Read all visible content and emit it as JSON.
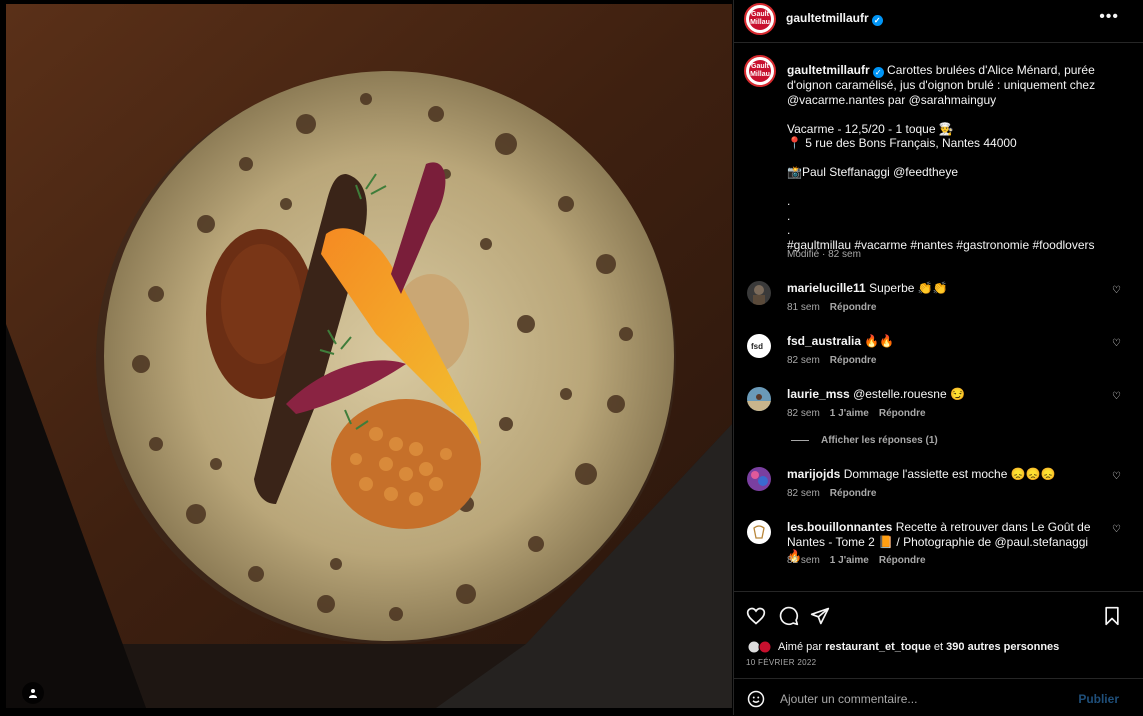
{
  "post": {
    "username": "gaultetmillaufr",
    "logo_text": "Gault Millau",
    "more_icon": "more-horizontal-icon",
    "caption": {
      "username": "gaultetmillaufr",
      "text": "Carottes brulées d'Alice Ménard, purée d'oignon caramélisé, jus d'oignon brulé : uniquement chez @vacarme.nantes par @sarahmainguy\n\nVacarme - 12,5/20 - 1 toque 👨‍🍳\n📍 5 rue des Bons Français, Nantes 44000\n\n📸Paul Steffanaggi @feedtheye\n\n.\n.\n.\n#gaultmillau #vacarme #nantes #gastronomie #foodlovers",
      "meta": "Modifié · 82 sem"
    }
  },
  "comments": [
    {
      "username": "marielucille11",
      "text": "Superbe 👏👏",
      "time": "81 sem",
      "likes": "",
      "reply": "Répondre",
      "avatar_color": "#3a3a3a"
    },
    {
      "username": "fsd_australia",
      "text": "🔥🔥",
      "time": "82 sem",
      "likes": "",
      "reply": "Répondre",
      "avatar_color": "#ffffff"
    },
    {
      "username": "laurie_mss",
      "text": "@estelle.rouesne 😏",
      "time": "82 sem",
      "likes": "1 J'aime",
      "reply": "Répondre",
      "avatar_color": "#6a9ab8"
    },
    {
      "username": "marijojds",
      "text": "Dommage l'assiette est moche 😞😞😞",
      "time": "82 sem",
      "likes": "",
      "reply": "Répondre",
      "avatar_color": "#7a3fa0"
    },
    {
      "username": "les.bouillonnantes",
      "text": "Recette à retrouver dans Le Goût de Nantes - Tome 2 📙 / Photographie de @paul.stefanaggi 🔥",
      "time": "82 sem",
      "likes": "1 J'aime",
      "reply": "Répondre",
      "avatar_color": "#ffffff"
    }
  ],
  "view_replies": "Afficher les réponses (1)",
  "likes": {
    "prefix": "Aimé par",
    "user": "restaurant_et_toque",
    "connector": "et",
    "others": "390 autres personnes"
  },
  "date": "10 FÉVRIER 2022",
  "composer": {
    "placeholder": "Ajouter un commentaire...",
    "publish": "Publier"
  },
  "colors": {
    "background": "#000000",
    "text": "#f5f5f5",
    "secondary": "#a8a8a8",
    "publish_disabled": "#1f4f7a",
    "verified": "#0095f6"
  }
}
